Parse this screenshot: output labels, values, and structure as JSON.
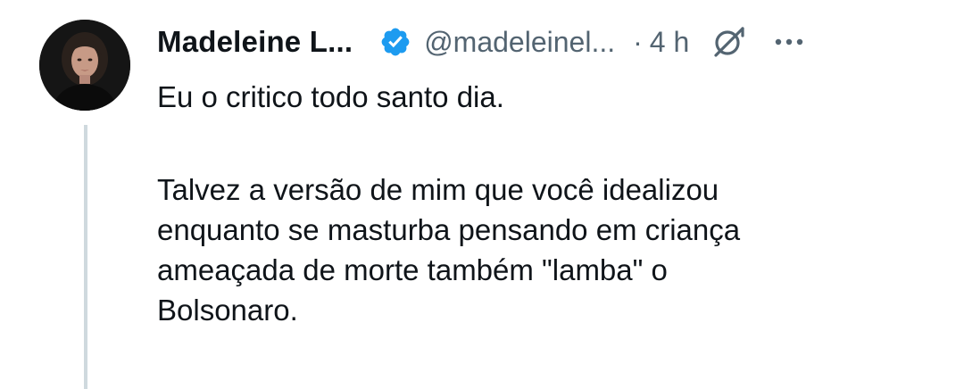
{
  "tweet": {
    "author_name": "Madeleine L...",
    "handle": "@madeleinel...",
    "separator": "·",
    "time": "4 h",
    "text_line1": "Eu o critico todo santo dia.",
    "text_para2": [
      "Talvez a versão de mim que você idealizou",
      "enquanto se masturba pensando em criança",
      "ameaçada de morte também \"lamba\" o",
      "Bolsonaro."
    ]
  },
  "icons": {
    "verified": "verified-badge-icon",
    "grok": "grok-icon",
    "more": "more-options-icon"
  },
  "colors": {
    "primary_text": "#0f1419",
    "secondary_text": "#536471",
    "verified_blue": "#1d9bf0",
    "thread_line": "#cfd9de"
  }
}
